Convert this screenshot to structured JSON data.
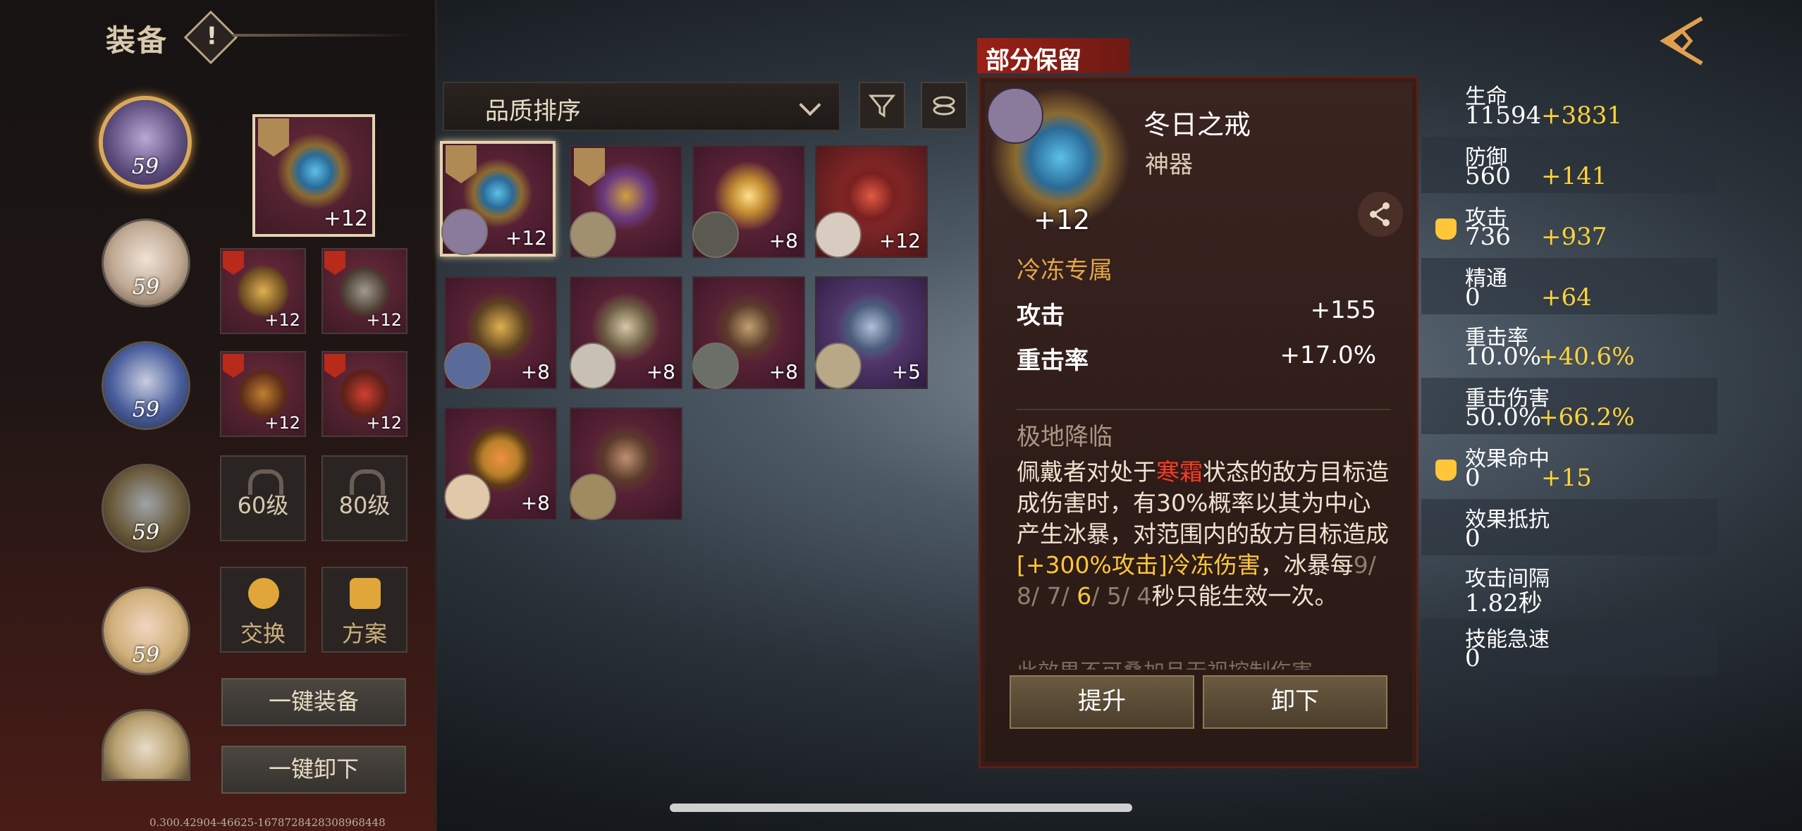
{
  "header": {
    "title": "装备",
    "info_icon": "!"
  },
  "heroes": [
    {
      "level": "59",
      "selected": true
    },
    {
      "level": "59"
    },
    {
      "level": "59"
    },
    {
      "level": "59"
    },
    {
      "level": "59"
    },
    {
      "level": ""
    }
  ],
  "equipped": {
    "ring_level": "+12",
    "slots": [
      "+12",
      "+12",
      "+12",
      "+12"
    ],
    "locks": [
      "60级",
      "80级"
    ],
    "tools": [
      "交换",
      "方案"
    ],
    "equip_all": "一键装备",
    "unequip_all": "一键卸下"
  },
  "version": "0.300.42904-46625-1678728428308968448",
  "sort": {
    "label": "品质排序"
  },
  "inventory": [
    "+12",
    "",
    "+8",
    "+12",
    "+8",
    "+8",
    "+8",
    "+5",
    "+8",
    ""
  ],
  "detail": {
    "tag": "部分保留",
    "name": "冬日之戒",
    "type": "神器",
    "level": "+12",
    "exclusive": "冷冻专属",
    "stats": [
      {
        "label": "攻击",
        "value": "+155"
      },
      {
        "label": "重击率",
        "value": "+17.0%"
      }
    ],
    "section": "极地降临",
    "desc_1": "佩戴者对处于",
    "desc_red": "寒霜",
    "desc_2": "状态的敌方目标造成伤害时，有30%概率以其为中心产生冰暴，对范围内的敌方目标造成",
    "desc_gold": "[+300%攻击]冷冻伤害",
    "desc_3": "，冰暴每",
    "cd_dim1": "9/ 8/ 7/ ",
    "cd_cur": "6",
    "cd_dim2": "/ 5/ 4",
    "desc_4": "秒只能生效一次。",
    "more": "此效果不可叠加且无视控制伤害",
    "upgrade": "提升",
    "remove": "卸下"
  },
  "stats_panel": [
    {
      "label": "生命",
      "value": "11594",
      "bonus": "+3831",
      "thumb": false
    },
    {
      "label": "防御",
      "value": "560",
      "bonus": "+141",
      "thumb": false
    },
    {
      "label": "攻击",
      "value": "736",
      "bonus": "+937",
      "thumb": true
    },
    {
      "label": "精通",
      "value": "0",
      "bonus": "+64",
      "thumb": false
    },
    {
      "label": "重击率",
      "value": "10.0%",
      "bonus": "+40.6%",
      "thumb": false
    },
    {
      "label": "重击伤害",
      "value": "50.0%",
      "bonus": "+66.2%",
      "thumb": false
    },
    {
      "label": "效果命中",
      "value": "0",
      "bonus": "+15",
      "thumb": true
    },
    {
      "label": "效果抵抗",
      "value": "0",
      "bonus": "",
      "thumb": false
    },
    {
      "label": "攻击间隔",
      "value": "1.82秒",
      "bonus": "",
      "thumb": false
    },
    {
      "label": "技能急速",
      "value": "0",
      "bonus": "",
      "thumb": false
    }
  ]
}
